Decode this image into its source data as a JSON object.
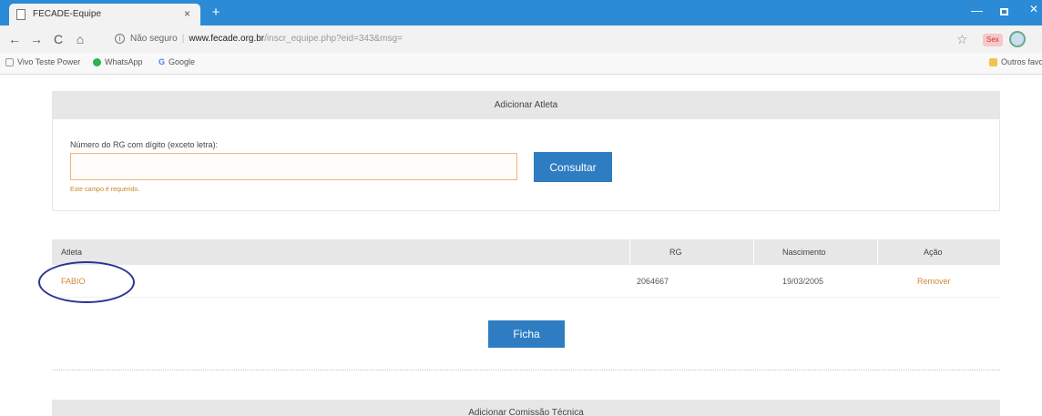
{
  "browser": {
    "tab_title": "FECADE-Equipe",
    "tab_close": "×",
    "new_tab": "+",
    "nav_back": "←",
    "nav_forward": "→",
    "nav_reload": "C",
    "nav_home": "⌂",
    "url_security": "Não seguro",
    "url_host": "www.fecade.org.br",
    "url_path": "/inscr_equipe.php?eid=343&msg=",
    "ext_badge": "Sex",
    "bookmarks": [
      {
        "label": "Vivo Teste Power",
        "color": "#9aa"
      },
      {
        "label": "WhatsApp",
        "color": "#2fb24c"
      },
      {
        "label": "Google",
        "color": "#4285f4"
      }
    ],
    "bookmark_other": "Outros favoritos",
    "window_min": "—",
    "window_close": "✕"
  },
  "form": {
    "header": "Adicionar Atleta",
    "rg_label": "Número do RG com dígito (exceto letra):",
    "rg_value": "",
    "consultar_label": "Consultar",
    "error_text": "Este campo é requerido."
  },
  "table": {
    "headers": [
      "Atleta",
      "RG",
      "Nascimento",
      "Ação"
    ],
    "rows": [
      {
        "atleta": "FABIO",
        "rg": "2064667",
        "nascimento": "19/03/2005",
        "acao": "Remover"
      }
    ]
  },
  "ficha_label": "Ficha",
  "next_section_header": "Adicionar Comissão Técnica",
  "colors": {
    "browser_accent": "#2b8bd6",
    "button": "#2e7dc2",
    "link": "#d4863a",
    "annotation_circle": "#2d3490"
  }
}
